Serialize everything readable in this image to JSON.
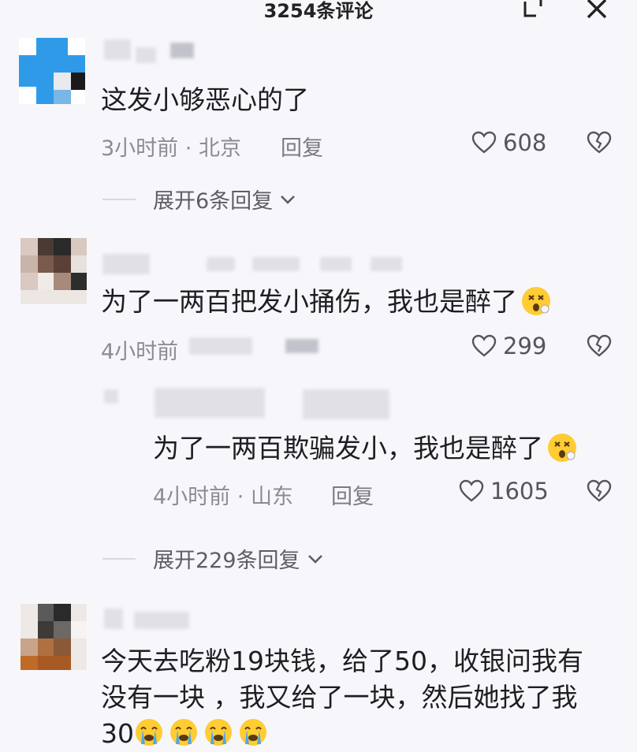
{
  "header": {
    "title": "3254条评论",
    "expand_icon": "expand-icon",
    "close_icon": "close-icon"
  },
  "comments": [
    {
      "text": "这发小够恶心的了",
      "time": "3小时前",
      "location": "北京",
      "reply_label": "回复",
      "likes": "608",
      "expand_label": "展开6条回复"
    },
    {
      "text": "为了一两百把发小捅伤，我也是醉了",
      "time": "4小时前",
      "likes": "299",
      "expand_label": "展开229条回复",
      "emoji": "dizzy-face-emoji",
      "reply": {
        "text": "为了一两百欺骗发小，我也是醉了",
        "time": "4小时前",
        "location": "山东",
        "reply_label": "回复",
        "likes": "1605",
        "emoji": "dizzy-face-emoji"
      }
    },
    {
      "text_line1": "今天去吃粉19块钱，给了50，收银问我有",
      "text_line2": "没有一块 ，我又给了一块，然后她找了我",
      "text_line3": "30",
      "emoji": "loudly-crying-face-emoji",
      "emoji_count": 4
    }
  ],
  "colors": {
    "background": "#f7f7fb",
    "text": "#1e1e22",
    "meta": "#8b8b92",
    "avatar_blue": "#2f9be8"
  }
}
